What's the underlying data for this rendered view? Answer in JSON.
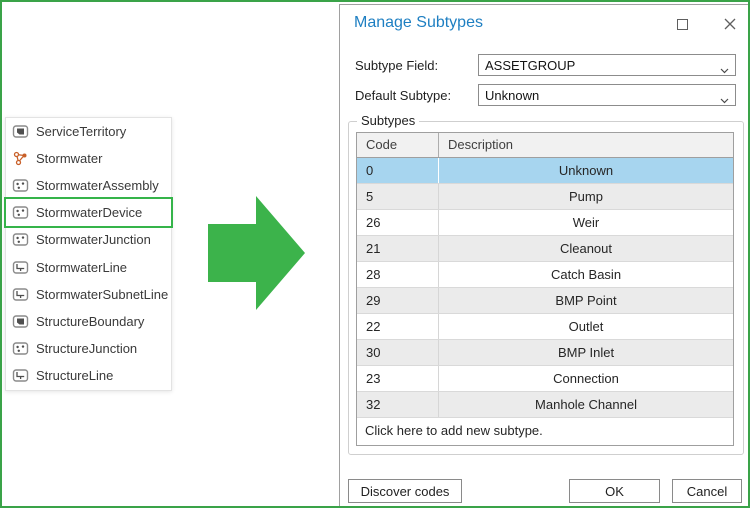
{
  "colors": {
    "frame_green": "#3aa348",
    "arrow_green": "#3cb34b",
    "highlight_green": "#35b44a",
    "title_blue": "#1e7fc2",
    "selection_blue": "#a7d5ef",
    "alt_row_gray": "#ebebeb"
  },
  "layer_list": {
    "items": [
      {
        "label": "ServiceTerritory",
        "icon": "polygon-icon",
        "highlighted": false
      },
      {
        "label": "Stormwater",
        "icon": "network-icon",
        "highlighted": false
      },
      {
        "label": "StormwaterAssembly",
        "icon": "point-icon",
        "highlighted": false
      },
      {
        "label": "StormwaterDevice",
        "icon": "point-icon",
        "highlighted": true
      },
      {
        "label": "StormwaterJunction",
        "icon": "point-icon",
        "highlighted": false
      },
      {
        "label": "StormwaterLine",
        "icon": "line-icon",
        "highlighted": false
      },
      {
        "label": "StormwaterSubnetLine",
        "icon": "line-icon",
        "highlighted": false
      },
      {
        "label": "StructureBoundary",
        "icon": "polygon-icon",
        "highlighted": false
      },
      {
        "label": "StructureJunction",
        "icon": "point-icon",
        "highlighted": false
      },
      {
        "label": "StructureLine",
        "icon": "line-icon",
        "highlighted": false
      }
    ]
  },
  "dialog": {
    "title": "Manage Subtypes",
    "subtype_field_label": "Subtype Field:",
    "subtype_field_value": "ASSETGROUP",
    "default_subtype_label": "Default Subtype:",
    "default_subtype_value": "Unknown",
    "group_label": "Subtypes",
    "table": {
      "columns": [
        "Code",
        "Description"
      ],
      "rows": [
        {
          "code": "0",
          "description": "Unknown",
          "selected": true
        },
        {
          "code": "5",
          "description": "Pump",
          "selected": false
        },
        {
          "code": "26",
          "description": "Weir",
          "selected": false
        },
        {
          "code": "21",
          "description": "Cleanout",
          "selected": false
        },
        {
          "code": "28",
          "description": "Catch Basin",
          "selected": false
        },
        {
          "code": "29",
          "description": "BMP Point",
          "selected": false
        },
        {
          "code": "22",
          "description": "Outlet",
          "selected": false
        },
        {
          "code": "30",
          "description": "BMP Inlet",
          "selected": false
        },
        {
          "code": "23",
          "description": "Connection",
          "selected": false
        },
        {
          "code": "32",
          "description": "Manhole Channel",
          "selected": false
        }
      ],
      "add_row_text": "Click here to add new subtype."
    },
    "buttons": {
      "discover": "Discover codes",
      "ok": "OK",
      "cancel": "Cancel"
    }
  }
}
